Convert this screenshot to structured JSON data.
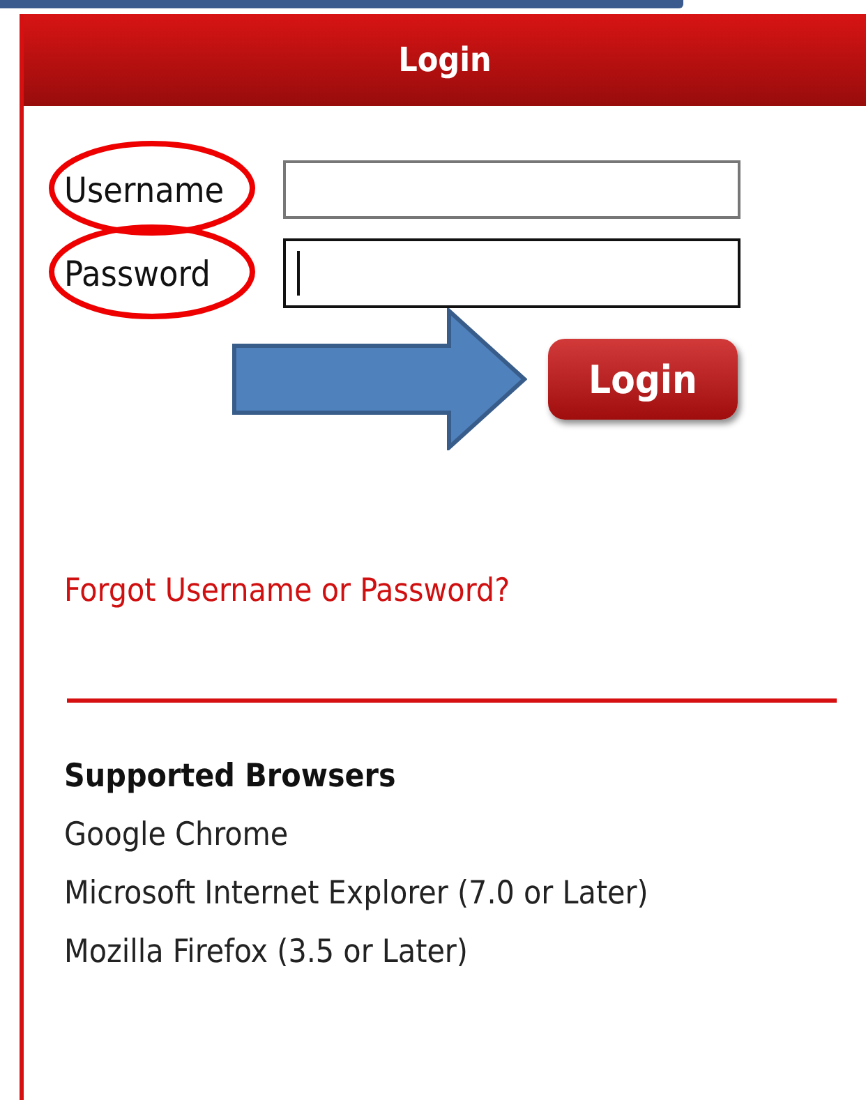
{
  "panel": {
    "title": "Login"
  },
  "fields": [
    {
      "label": "Username",
      "circled": true,
      "focused": false
    },
    {
      "label": "Password",
      "circled": true,
      "focused": true
    }
  ],
  "login_button": {
    "label": "Login",
    "pointed_at": true
  },
  "forgot_link": "Forgot Username or Password?",
  "supported": {
    "heading": "Supported Browsers",
    "browsers": [
      "Google Chrome",
      "Microsoft Internet Explorer (7.0 or Later)",
      "Mozilla Firefox (3.5 or Later)"
    ]
  }
}
